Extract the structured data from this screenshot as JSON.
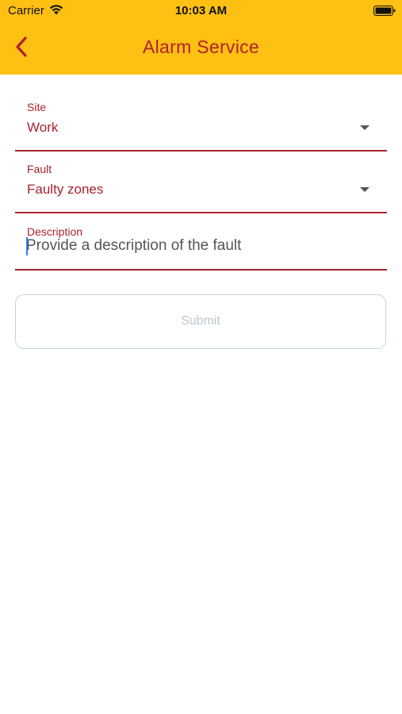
{
  "status_bar": {
    "carrier": "Carrier",
    "time": "10:03 AM"
  },
  "header": {
    "title": "Alarm Service",
    "background_color": "#FDC013",
    "accent_color": "#B0212C"
  },
  "form": {
    "site": {
      "label": "Site",
      "value": "Work"
    },
    "fault": {
      "label": "Fault",
      "value": "Faulty zones"
    },
    "description": {
      "label": "Description",
      "value": "",
      "placeholder": "Provide a description of the fault"
    },
    "submit_label": "Submit"
  }
}
